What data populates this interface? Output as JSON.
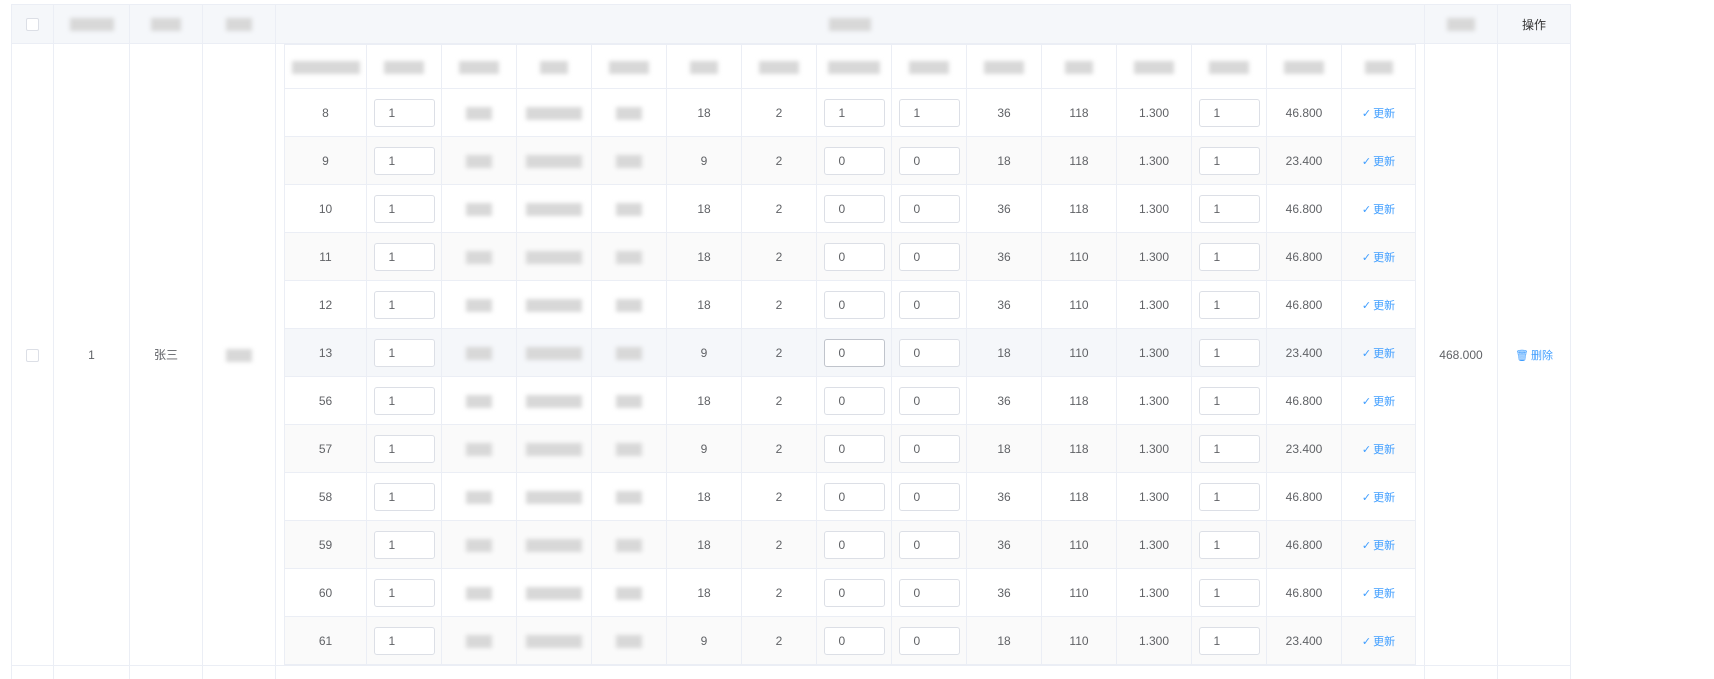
{
  "header": {
    "action_label": "操作"
  },
  "main_row": {
    "index": "1",
    "name": "张三",
    "total": "468.000",
    "delete_label": "删除"
  },
  "icons": {
    "check": "check-icon",
    "trash": "trash-icon"
  },
  "accent_color": "#409eff",
  "inner": {
    "update_label": "更新",
    "rows": [
      {
        "id": "8",
        "f1": "1",
        "a": "18",
        "b": "2",
        "i1": "1",
        "i2": "1",
        "c": "36",
        "d": "118",
        "e": "1.300",
        "f2": "1",
        "g": "46.800"
      },
      {
        "id": "9",
        "f1": "1",
        "a": "9",
        "b": "2",
        "i1": "0",
        "i2": "0",
        "c": "18",
        "d": "118",
        "e": "1.300",
        "f2": "1",
        "g": "23.400"
      },
      {
        "id": "10",
        "f1": "1",
        "a": "18",
        "b": "2",
        "i1": "0",
        "i2": "0",
        "c": "36",
        "d": "118",
        "e": "1.300",
        "f2": "1",
        "g": "46.800"
      },
      {
        "id": "11",
        "f1": "1",
        "a": "18",
        "b": "2",
        "i1": "0",
        "i2": "0",
        "c": "36",
        "d": "110",
        "e": "1.300",
        "f2": "1",
        "g": "46.800"
      },
      {
        "id": "12",
        "f1": "1",
        "a": "18",
        "b": "2",
        "i1": "0",
        "i2": "0",
        "c": "36",
        "d": "110",
        "e": "1.300",
        "f2": "1",
        "g": "46.800"
      },
      {
        "id": "13",
        "f1": "1",
        "a": "9",
        "b": "2",
        "i1": "0",
        "i2": "0",
        "c": "18",
        "d": "110",
        "e": "1.300",
        "f2": "1",
        "g": "23.400"
      },
      {
        "id": "56",
        "f1": "1",
        "a": "18",
        "b": "2",
        "i1": "0",
        "i2": "0",
        "c": "36",
        "d": "118",
        "e": "1.300",
        "f2": "1",
        "g": "46.800"
      },
      {
        "id": "57",
        "f1": "1",
        "a": "9",
        "b": "2",
        "i1": "0",
        "i2": "0",
        "c": "18",
        "d": "118",
        "e": "1.300",
        "f2": "1",
        "g": "23.400"
      },
      {
        "id": "58",
        "f1": "1",
        "a": "18",
        "b": "2",
        "i1": "0",
        "i2": "0",
        "c": "36",
        "d": "118",
        "e": "1.300",
        "f2": "1",
        "g": "46.800"
      },
      {
        "id": "59",
        "f1": "1",
        "a": "18",
        "b": "2",
        "i1": "0",
        "i2": "0",
        "c": "36",
        "d": "110",
        "e": "1.300",
        "f2": "1",
        "g": "46.800"
      },
      {
        "id": "60",
        "f1": "1",
        "a": "18",
        "b": "2",
        "i1": "0",
        "i2": "0",
        "c": "36",
        "d": "110",
        "e": "1.300",
        "f2": "1",
        "g": "46.800"
      },
      {
        "id": "61",
        "f1": "1",
        "a": "9",
        "b": "2",
        "i1": "0",
        "i2": "0",
        "c": "18",
        "d": "110",
        "e": "1.300",
        "f2": "1",
        "g": "23.400"
      }
    ]
  }
}
